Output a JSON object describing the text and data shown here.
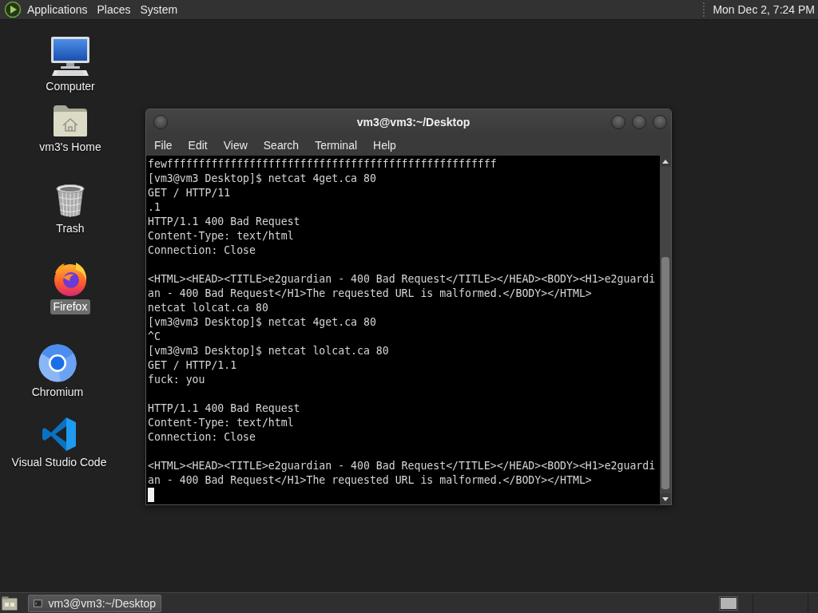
{
  "top_panel": {
    "menus": [
      {
        "label": "Applications"
      },
      {
        "label": "Places"
      },
      {
        "label": "System"
      }
    ],
    "clock": "Mon Dec 2, 7:24 PM"
  },
  "desktop_icons": [
    {
      "kind": "computer",
      "label": "Computer",
      "selected": false
    },
    {
      "kind": "home",
      "label": "vm3's Home",
      "selected": false
    },
    {
      "kind": "trash",
      "label": "Trash",
      "selected": false
    },
    {
      "kind": "firefox",
      "label": "Firefox",
      "selected": true
    },
    {
      "kind": "chromium",
      "label": "Chromium",
      "selected": false
    },
    {
      "kind": "vscode",
      "label": "Visual Studio Code",
      "selected": false
    }
  ],
  "terminal": {
    "title": "vm3@vm3:~/Desktop",
    "menu": [
      "File",
      "Edit",
      "View",
      "Search",
      "Terminal",
      "Help"
    ],
    "lines": [
      {
        "kind": "text",
        "text": "fewffffffffffffffffffffffffffffffffffffffffffffffffffff"
      },
      {
        "kind": "text",
        "text": "[vm3@vm3 Desktop]$ netcat 4get.ca 80"
      },
      {
        "kind": "text",
        "text": "GET / HTTP/11"
      },
      {
        "kind": "text",
        "text": ".1"
      },
      {
        "kind": "text",
        "text": "HTTP/1.1 400 Bad Request"
      },
      {
        "kind": "text",
        "text": "Content-Type: text/html"
      },
      {
        "kind": "text",
        "text": "Connection: Close"
      },
      {
        "kind": "blank"
      },
      {
        "kind": "text",
        "text": "<HTML><HEAD><TITLE>e2guardian - 400 Bad Request</TITLE></HEAD><BODY><H1>e2guardi"
      },
      {
        "kind": "text",
        "text": "an - 400 Bad Request</H1>The requested URL is malformed.</BODY></HTML>"
      },
      {
        "kind": "text",
        "text": "netcat lolcat.ca 80"
      },
      {
        "kind": "text",
        "text": "[vm3@vm3 Desktop]$ netcat 4get.ca 80"
      },
      {
        "kind": "text",
        "text": "^C"
      },
      {
        "kind": "text",
        "text": "[vm3@vm3 Desktop]$ netcat lolcat.ca 80"
      },
      {
        "kind": "text",
        "text": "GET / HTTP/1.1"
      },
      {
        "kind": "text",
        "text": "fuck: you"
      },
      {
        "kind": "blank"
      },
      {
        "kind": "text",
        "text": "HTTP/1.1 400 Bad Request"
      },
      {
        "kind": "text",
        "text": "Content-Type: text/html"
      },
      {
        "kind": "text",
        "text": "Connection: Close"
      },
      {
        "kind": "blank"
      },
      {
        "kind": "text",
        "text": "<HTML><HEAD><TITLE>e2guardian - 400 Bad Request</TITLE></HEAD><BODY><H1>e2guardi"
      },
      {
        "kind": "text",
        "text": "an - 400 Bad Request</H1>The requested URL is malformed.</BODY></HTML>"
      },
      {
        "kind": "cursor"
      }
    ]
  },
  "taskbar": {
    "tasks": [
      {
        "label": "vm3@vm3:~/Desktop",
        "selected": true
      }
    ]
  }
}
